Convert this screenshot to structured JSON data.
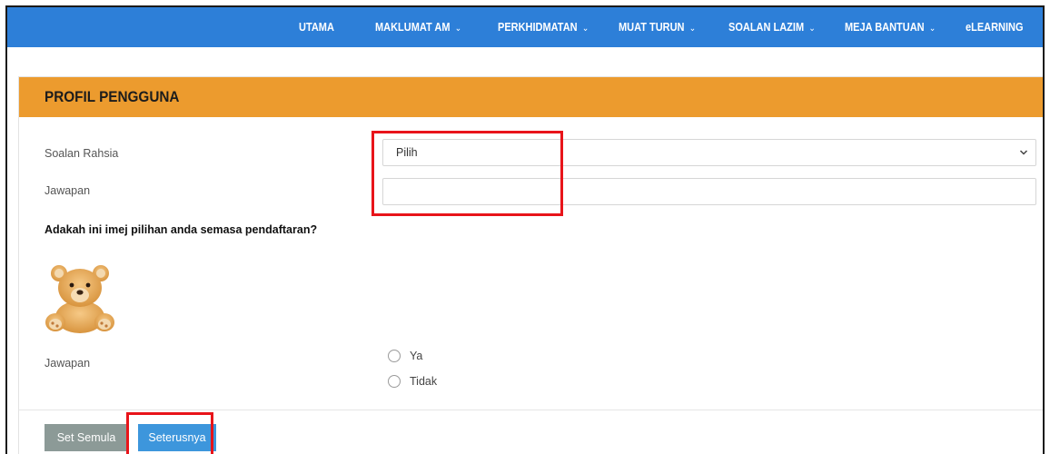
{
  "nav": {
    "items": [
      {
        "label": "UTAMA",
        "has_dropdown": false
      },
      {
        "label": "MAKLUMAT AM",
        "has_dropdown": true
      },
      {
        "label": "PERKHIDMATAN",
        "has_dropdown": true
      },
      {
        "label": "MUAT TURUN",
        "has_dropdown": true
      },
      {
        "label": "SOALAN LAZIM",
        "has_dropdown": true
      },
      {
        "label": "MEJA BANTUAN",
        "has_dropdown": true
      },
      {
        "label": "eLEARNING",
        "has_dropdown": false
      }
    ],
    "background_color": "#2d7fd8"
  },
  "panel": {
    "title": "PROFIL PENGGUNA",
    "heading_color": "#ec9b2e"
  },
  "form": {
    "secret_question_label": "Soalan Rahsia",
    "secret_question_value": "Pilih",
    "answer_label": "Jawapan",
    "answer_value": "",
    "image_question": "Adakah ini imej pilihan anda semasa pendaftaran?",
    "image_icon": "teddy-bear",
    "image_answer_label": "Jawapan",
    "options": [
      {
        "label": "Ya",
        "selected": false
      },
      {
        "label": "Tidak",
        "selected": false
      }
    ]
  },
  "buttons": {
    "reset_label": "Set Semula",
    "next_label": "Seterusnya"
  },
  "highlight_color": "#e8141a"
}
